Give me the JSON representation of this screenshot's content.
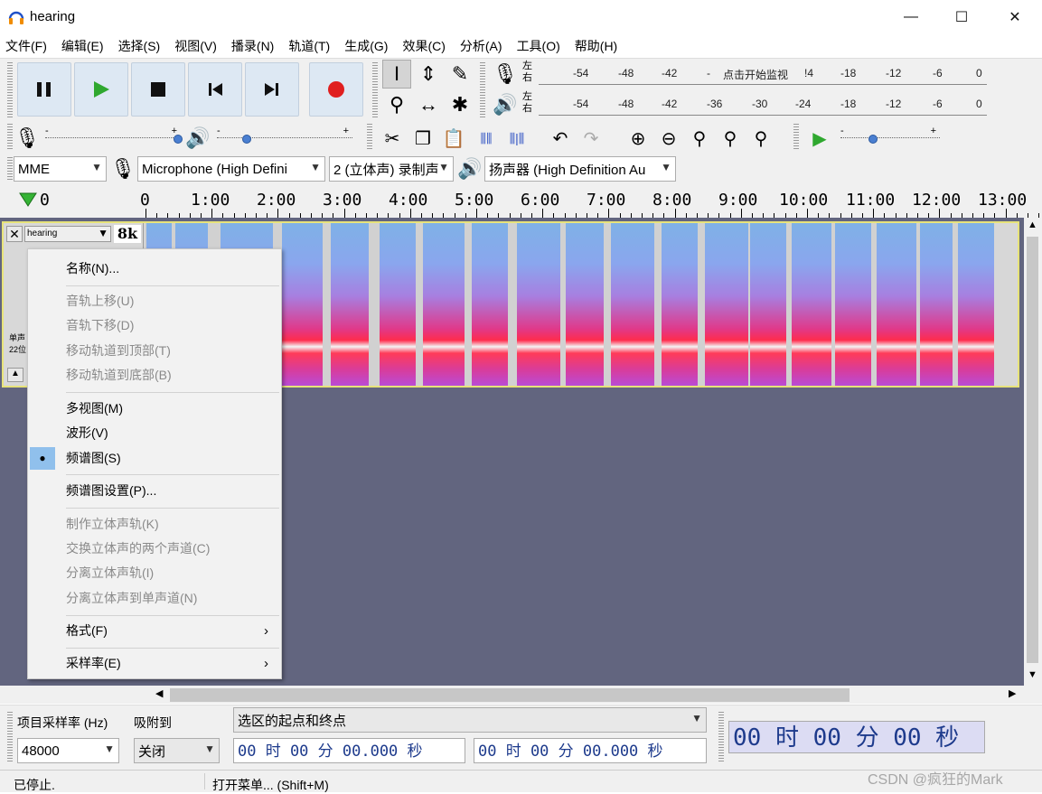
{
  "window": {
    "title": "hearing",
    "minimize": "—",
    "maximize": "☐",
    "close": "✕"
  },
  "menu": [
    "文件(F)",
    "编辑(E)",
    "选择(S)",
    "视图(V)",
    "播录(N)",
    "轨道(T)",
    "生成(G)",
    "效果(C)",
    "分析(A)",
    "工具(O)",
    "帮助(H)"
  ],
  "meter": {
    "left_right": [
      "左",
      "右"
    ],
    "record_ticks": [
      "-54",
      "-48",
      "-42",
      "-",
      "点击开始监视",
      "!4",
      "-18",
      "-12",
      "-6",
      "0"
    ],
    "play_ticks": [
      "-54",
      "-48",
      "-42",
      "-36",
      "-30",
      "-24",
      "-18",
      "-12",
      "-6",
      "0"
    ],
    "slider_minus": "-",
    "slider_plus": "+"
  },
  "device": {
    "host": "MME",
    "input": "Microphone (High Defini",
    "channels": "2 (立体声) 录制声",
    "output": "扬声器 (High Definition Au"
  },
  "timeline": {
    "labels": [
      "0",
      "0",
      "1:00",
      "2:00",
      "3:00",
      "4:00",
      "5:00",
      "6:00",
      "7:00",
      "8:00",
      "9:00",
      "10:00",
      "11:00",
      "12:00",
      "13:00"
    ]
  },
  "track": {
    "name": "hearing",
    "rate_badge": "8k",
    "close": "✕",
    "collapse": "▲",
    "info_mono": "单声",
    "info_bits": "22位"
  },
  "context_menu": {
    "items": [
      {
        "label": "名称(N)...",
        "enabled": true
      },
      {
        "label": "音轨上移(U)",
        "enabled": false
      },
      {
        "label": "音轨下移(D)",
        "enabled": false
      },
      {
        "label": "移动轨道到顶部(T)",
        "enabled": false
      },
      {
        "label": "移动轨道到底部(B)",
        "enabled": false
      },
      {
        "label": "多视图(M)",
        "enabled": true
      },
      {
        "label": "波形(V)",
        "enabled": true
      },
      {
        "label": "频谱图(S)",
        "enabled": true,
        "checked": true
      },
      {
        "label": "频谱图设置(P)...",
        "enabled": true
      },
      {
        "label": "制作立体声轨(K)",
        "enabled": false
      },
      {
        "label": "交换立体声的两个声道(C)",
        "enabled": false
      },
      {
        "label": "分离立体声轨(I)",
        "enabled": false
      },
      {
        "label": "分离立体声到单声道(N)",
        "enabled": false
      },
      {
        "label": "格式(F)",
        "enabled": true,
        "submenu": true
      },
      {
        "label": "采样率(E)",
        "enabled": true,
        "submenu": true
      }
    ],
    "check_mark": "●",
    "submenu_arrow": "›"
  },
  "selection": {
    "rate_label": "项目采样率 (Hz)",
    "snap_label": "吸附到",
    "rate_value": "48000",
    "snap_value": "关闭",
    "mode": "选区的起点和终点",
    "start": "00 时 00 分 00.000 秒",
    "end": "00 时 00 分 00.000 秒",
    "audio_position": "00 时 00 分 00 秒"
  },
  "status": {
    "state": "已停止.",
    "hint": "打开菜单... (Shift+M)"
  },
  "watermark": "CSDN @疯狂的Mark"
}
